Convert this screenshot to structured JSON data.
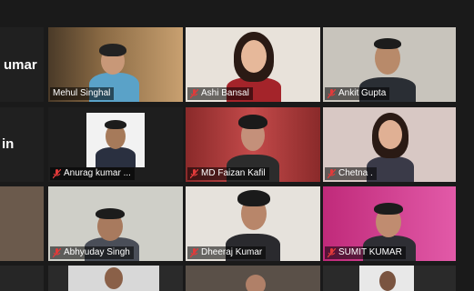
{
  "colors": {
    "background": "#1a1a1a",
    "active_speaker_border": "#d6e24a",
    "muted_mic": "#e23a3a"
  },
  "partial_labels": [
    "umar",
    "in"
  ],
  "participants": [
    {
      "name": "Mehul Singhal",
      "muted": false,
      "active": true
    },
    {
      "name": "Ashi Bansal",
      "muted": true
    },
    {
      "name": "Ankit Gupta",
      "muted": true
    },
    {
      "name": "Anurag kumar ...",
      "muted": true
    },
    {
      "name": "MD Faizan Kafil",
      "muted": true
    },
    {
      "name": "Chetna .",
      "muted": true
    },
    {
      "name": "Abhyuday Singh",
      "muted": true
    },
    {
      "name": "Dheeraj Kumar",
      "muted": true
    },
    {
      "name": "SUMIT KUMAR",
      "muted": true
    }
  ]
}
